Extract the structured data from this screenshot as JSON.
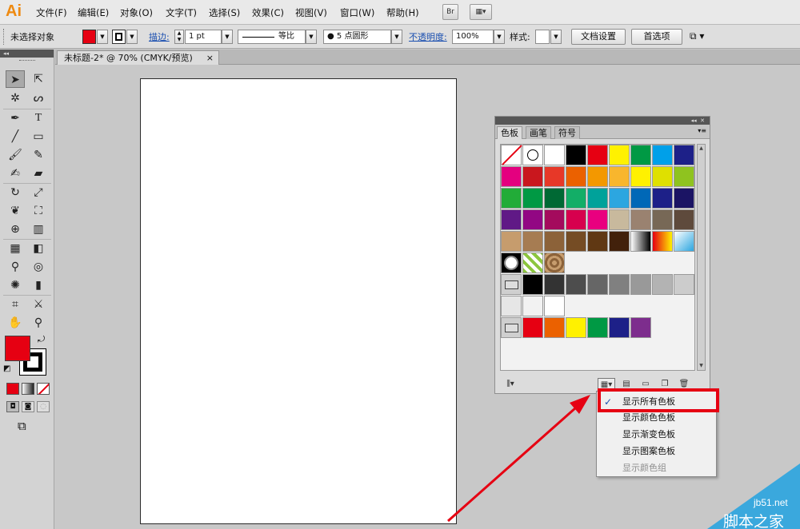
{
  "app": {
    "logo": "Ai"
  },
  "menubar": {
    "items": [
      "文件(F)",
      "编辑(E)",
      "对象(O)",
      "文字(T)",
      "选择(S)",
      "效果(C)",
      "视图(V)",
      "窗口(W)",
      "帮助(H)"
    ],
    "bridge_label": "Br",
    "arrange_label": "▦▾"
  },
  "control": {
    "selection": "未选择对象",
    "stroke_label": "描边:",
    "stroke_weight": "1 pt",
    "line_style": "等比",
    "brush": "● 5 点圆形",
    "opacity_label": "不透明度:",
    "opacity": "100%",
    "style_label": "样式:",
    "doc_setup": "文档设置",
    "prefs": "首选项",
    "fill_color": "#e60012"
  },
  "document": {
    "tab_title": "未标题-2* @ 70% (CMYK/预览)",
    "close": "×"
  },
  "swatches": {
    "tabs": [
      "色板",
      "画笔",
      "符号"
    ],
    "rows": [
      [
        "#ffffff",
        "#ffffff",
        "#ffffff",
        "#000000",
        "#e60012",
        "#fff100",
        "#009944",
        "#00a0e9",
        "#1d2088"
      ],
      [
        "#e4007f",
        "#c9171e",
        "#e73828",
        "#eb6100",
        "#f39800",
        "#f8b62d",
        "#fff100",
        "#dfe000",
        "#8fc31f"
      ],
      [
        "#22ac38",
        "#009944",
        "#006934",
        "#13ae67",
        "#00a29a",
        "#2ca6e0",
        "#0068b7",
        "#1d2088",
        "#1b1464"
      ],
      [
        "#601986",
        "#920783",
        "#a40b5d",
        "#d7004e",
        "#e9007f",
        "#c8b99d",
        "#9a8270",
        "#776856",
        "#5e4a3c"
      ],
      [
        "#c69c6d",
        "#a67c52",
        "#8c6239",
        "#754c24",
        "#603813",
        "#42210b",
        "#808080",
        "#f7b52c",
        "#9bbce4"
      ],
      [
        "#cccccc",
        "#6ab04c",
        "#a46e3c"
      ],
      [
        "#999999",
        "#000000",
        "#333333",
        "#4d4d4d",
        "#666666",
        "#808080",
        "#999999",
        "#b3b3b3",
        "#cccccc"
      ],
      [
        "#e6e6e6",
        "#f2f2f2",
        "#ffffff"
      ],
      [
        "#999999",
        "#e60012",
        "#eb6100",
        "#fff100",
        "#009944",
        "#1d2088",
        "#7d2d8d"
      ]
    ]
  },
  "menu": {
    "items": [
      "显示所有色板",
      "显示颜色色板",
      "显示渐变色板",
      "显示图案色板",
      "显示颜色组"
    ],
    "check": "✓"
  },
  "watermark": {
    "domain": "jb51.net",
    "text": "脚本之家"
  },
  "colors": {
    "accent": "#e60012",
    "watermark_bg": "#3aa8dd"
  }
}
